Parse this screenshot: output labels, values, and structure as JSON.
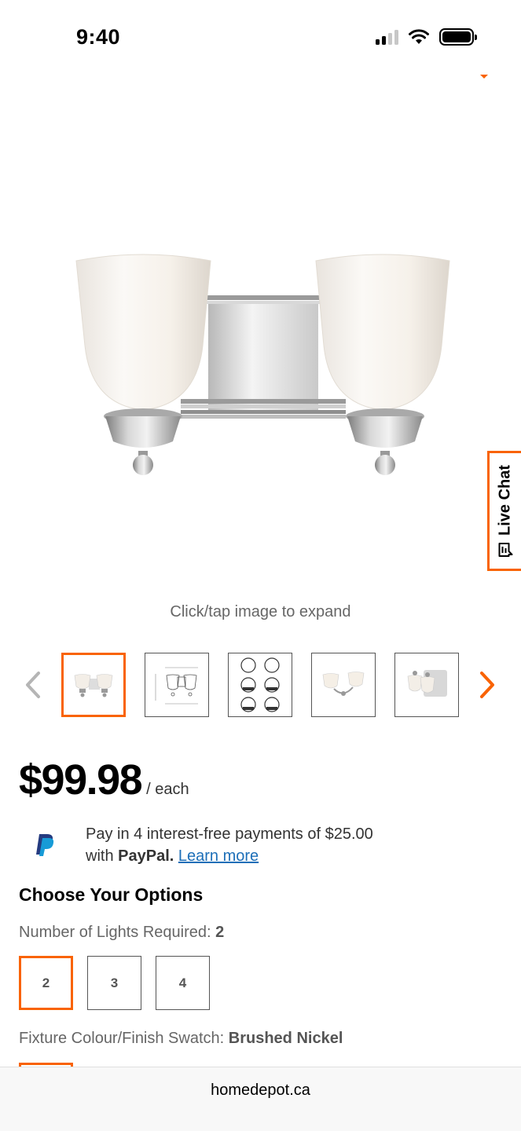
{
  "status_bar": {
    "time": "9:40",
    "icons": [
      "cellular-signal-icon",
      "wifi-icon",
      "battery-icon"
    ]
  },
  "product": {
    "image_hint": "Click/tap image to expand",
    "thumbnails": [
      {
        "name": "vanity-light-front",
        "selected": true
      },
      {
        "name": "dimension-drawing",
        "selected": false
      },
      {
        "name": "feature-icons",
        "selected": false
      },
      {
        "name": "vanity-light-lit",
        "selected": false
      },
      {
        "name": "vanity-light-angled",
        "selected": false
      }
    ],
    "price": "$99.98",
    "price_unit": "/ each"
  },
  "paypal": {
    "line1": "Pay in 4 interest-free payments of $25.00",
    "line2_prefix": "with",
    "brand": "PayPal.",
    "learn_more": "Learn more"
  },
  "live_chat": {
    "label": "Live Chat"
  },
  "options": {
    "heading": "Choose Your Options",
    "lights_label": "Number of Lights Required:",
    "lights_selected": "2",
    "lights_values": [
      "2",
      "3",
      "4"
    ],
    "finish_label": "Fixture Colour/Finish Swatch:",
    "finish_selected": "Brushed Nickel"
  },
  "browser": {
    "url": "homedepot.ca"
  },
  "colors": {
    "accent": "#f96302",
    "link": "#1d6fb8"
  }
}
